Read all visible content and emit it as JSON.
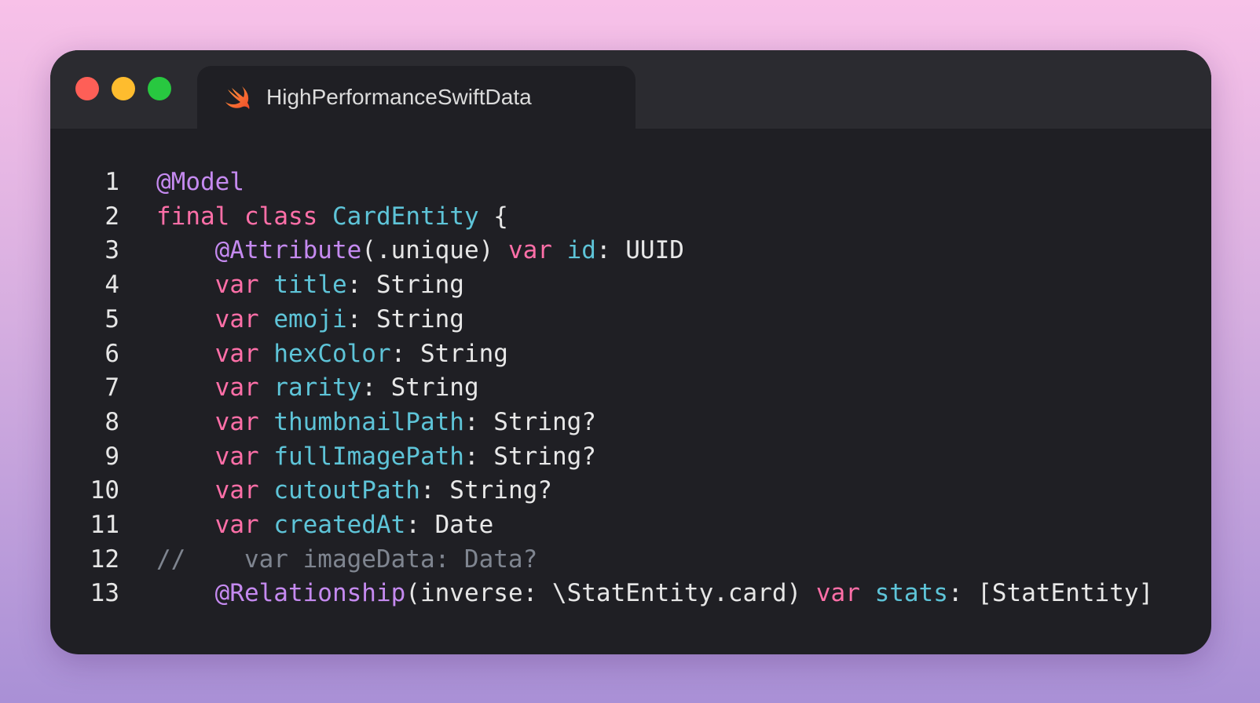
{
  "colors": {
    "background_top": "#f8c1e8",
    "background_bottom": "#a990d6",
    "window": "#1f1f24",
    "titlebar": "#2b2b30",
    "traffic_red": "#fe5f57",
    "traffic_yellow": "#febc2e",
    "traffic_green": "#28c840",
    "keyword": "#ff6fa8",
    "attribute": "#c58af0",
    "identifier": "#5ec4d8",
    "comment": "#7f8590"
  },
  "window": {
    "tab": {
      "icon": "swift-icon",
      "title": "HighPerformanceSwiftData"
    }
  },
  "code": {
    "lines": [
      {
        "n": "1",
        "tokens": [
          {
            "t": "@Model",
            "c": "attr"
          }
        ]
      },
      {
        "n": "2",
        "tokens": [
          {
            "t": "final",
            "c": "kw"
          },
          {
            "t": " ",
            "c": "plain"
          },
          {
            "t": "class",
            "c": "kw"
          },
          {
            "t": " ",
            "c": "plain"
          },
          {
            "t": "CardEntity",
            "c": "ident"
          },
          {
            "t": " {",
            "c": "plain"
          }
        ]
      },
      {
        "n": "3",
        "tokens": [
          {
            "t": "    ",
            "c": "plain"
          },
          {
            "t": "@Attribute",
            "c": "attr"
          },
          {
            "t": "(.unique) ",
            "c": "plain"
          },
          {
            "t": "var",
            "c": "kw"
          },
          {
            "t": " ",
            "c": "plain"
          },
          {
            "t": "id",
            "c": "ident"
          },
          {
            "t": ": ",
            "c": "plain"
          },
          {
            "t": "UUID",
            "c": "typ"
          }
        ]
      },
      {
        "n": "4",
        "tokens": [
          {
            "t": "    ",
            "c": "plain"
          },
          {
            "t": "var",
            "c": "kw"
          },
          {
            "t": " ",
            "c": "plain"
          },
          {
            "t": "title",
            "c": "ident"
          },
          {
            "t": ": ",
            "c": "plain"
          },
          {
            "t": "String",
            "c": "typ"
          }
        ]
      },
      {
        "n": "5",
        "tokens": [
          {
            "t": "    ",
            "c": "plain"
          },
          {
            "t": "var",
            "c": "kw"
          },
          {
            "t": " ",
            "c": "plain"
          },
          {
            "t": "emoji",
            "c": "ident"
          },
          {
            "t": ": ",
            "c": "plain"
          },
          {
            "t": "String",
            "c": "typ"
          }
        ]
      },
      {
        "n": "6",
        "tokens": [
          {
            "t": "    ",
            "c": "plain"
          },
          {
            "t": "var",
            "c": "kw"
          },
          {
            "t": " ",
            "c": "plain"
          },
          {
            "t": "hexColor",
            "c": "ident"
          },
          {
            "t": ": ",
            "c": "plain"
          },
          {
            "t": "String",
            "c": "typ"
          }
        ]
      },
      {
        "n": "7",
        "tokens": [
          {
            "t": "    ",
            "c": "plain"
          },
          {
            "t": "var",
            "c": "kw"
          },
          {
            "t": " ",
            "c": "plain"
          },
          {
            "t": "rarity",
            "c": "ident"
          },
          {
            "t": ": ",
            "c": "plain"
          },
          {
            "t": "String",
            "c": "typ"
          }
        ]
      },
      {
        "n": "8",
        "tokens": [
          {
            "t": "    ",
            "c": "plain"
          },
          {
            "t": "var",
            "c": "kw"
          },
          {
            "t": " ",
            "c": "plain"
          },
          {
            "t": "thumbnailPath",
            "c": "ident"
          },
          {
            "t": ": ",
            "c": "plain"
          },
          {
            "t": "String?",
            "c": "typ"
          }
        ]
      },
      {
        "n": "9",
        "tokens": [
          {
            "t": "    ",
            "c": "plain"
          },
          {
            "t": "var",
            "c": "kw"
          },
          {
            "t": " ",
            "c": "plain"
          },
          {
            "t": "fullImagePath",
            "c": "ident"
          },
          {
            "t": ": ",
            "c": "plain"
          },
          {
            "t": "String?",
            "c": "typ"
          }
        ]
      },
      {
        "n": "10",
        "tokens": [
          {
            "t": "    ",
            "c": "plain"
          },
          {
            "t": "var",
            "c": "kw"
          },
          {
            "t": " ",
            "c": "plain"
          },
          {
            "t": "cutoutPath",
            "c": "ident"
          },
          {
            "t": ": ",
            "c": "plain"
          },
          {
            "t": "String?",
            "c": "typ"
          }
        ]
      },
      {
        "n": "11",
        "tokens": [
          {
            "t": "    ",
            "c": "plain"
          },
          {
            "t": "var",
            "c": "kw"
          },
          {
            "t": " ",
            "c": "plain"
          },
          {
            "t": "createdAt",
            "c": "ident"
          },
          {
            "t": ": ",
            "c": "plain"
          },
          {
            "t": "Date",
            "c": "typ"
          }
        ]
      },
      {
        "n": "12",
        "tokens": [
          {
            "t": "//    var imageData: Data?",
            "c": "comment"
          }
        ]
      },
      {
        "n": "13",
        "tokens": [
          {
            "t": "    ",
            "c": "plain"
          },
          {
            "t": "@Relationship",
            "c": "attr"
          },
          {
            "t": "(inverse: \\StatEntity.card) ",
            "c": "plain"
          },
          {
            "t": "var",
            "c": "kw"
          },
          {
            "t": " ",
            "c": "plain"
          },
          {
            "t": "stats",
            "c": "ident"
          },
          {
            "t": ": ",
            "c": "plain"
          },
          {
            "t": "[StatEntity]",
            "c": "typ"
          }
        ]
      }
    ]
  }
}
